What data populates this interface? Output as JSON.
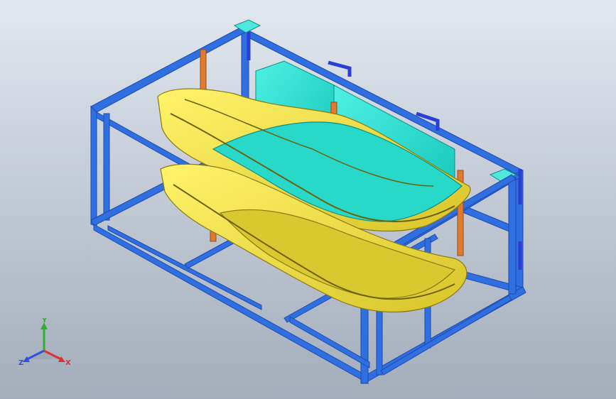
{
  "viewport": {
    "background_top": "#e3e8ef",
    "background_bottom": "#a3adbb"
  },
  "model": {
    "frame_color": "#2f6fe0",
    "frame_dark": "#1c4bb0",
    "post_color": "#e07a2e",
    "panel_color": "#20e0d0",
    "part_color": "#f2e23a",
    "part_shadow": "#b9a81e",
    "handle_color": "#2b3fd6"
  },
  "triad": {
    "x_label": "X",
    "y_label": "Y",
    "z_label": "Z",
    "x_color": "#e03030",
    "y_color": "#30b030",
    "z_color": "#3050e0",
    "icon": "coordinate-triad-icon"
  }
}
